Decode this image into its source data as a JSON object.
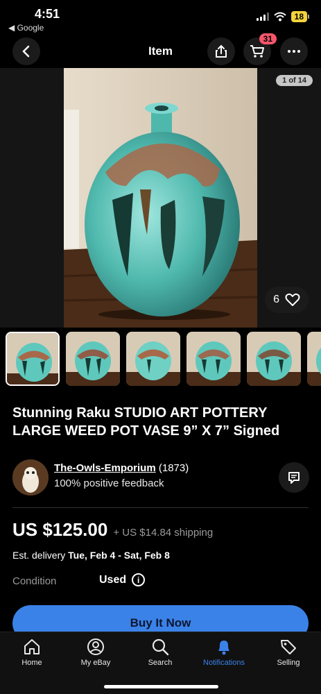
{
  "status_bar": {
    "time": "4:51",
    "back_app": "◀ Google",
    "battery": "18"
  },
  "nav": {
    "title": "Item",
    "cart_count": "31"
  },
  "gallery": {
    "counter": "1 of 14",
    "like_count": "6",
    "thumbnail_count": 6
  },
  "listing": {
    "title": "Stunning Raku STUDIO ART POTTERY LARGE WEED POT VASE 9” X 7” Signed",
    "price": "US $125.00",
    "shipping": "+ US $14.84 shipping",
    "delivery_label": "Est. delivery",
    "delivery_dates": "Tue, Feb 4 - Sat, Feb 8",
    "condition_label": "Condition",
    "condition_value": "Used"
  },
  "seller": {
    "name": "The-Owls-Emporium",
    "rating_count": "(1873)",
    "feedback": "100% positive feedback"
  },
  "buy_button": "Buy It Now",
  "tabs": [
    {
      "label": "Home",
      "icon": "home-icon"
    },
    {
      "label": "My eBay",
      "icon": "user-icon"
    },
    {
      "label": "Search",
      "icon": "search-icon"
    },
    {
      "label": "Notifications",
      "icon": "bell-icon",
      "active": true
    },
    {
      "label": "Selling",
      "icon": "tag-icon"
    }
  ],
  "colors": {
    "accent": "#3b82e8",
    "badge": "#f5566c",
    "vase_glaze": "#5fc8bc"
  }
}
